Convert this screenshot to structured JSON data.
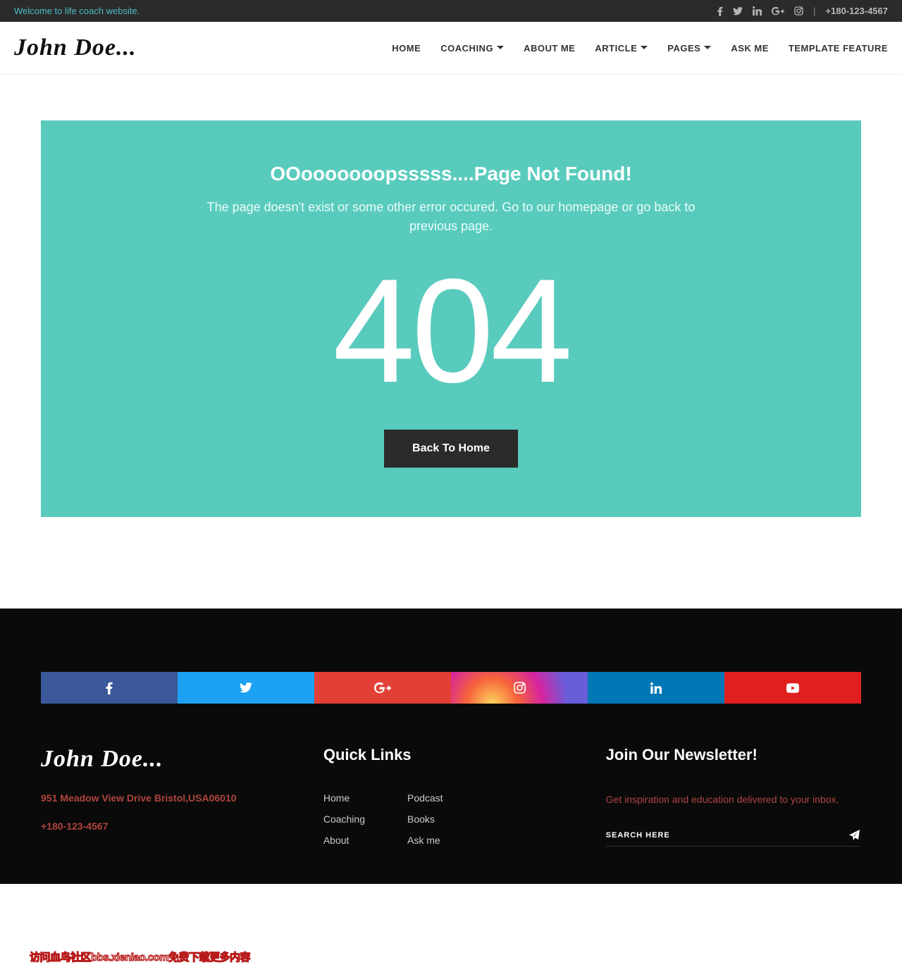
{
  "topbar": {
    "welcome": "Welcome to life coach website.",
    "phone": "+180-123-4567"
  },
  "logo": "John Doe...",
  "nav": {
    "home": "HOME",
    "coaching": "COACHING",
    "about": "ABOUT ME",
    "article": "ARTICLE",
    "pages": "PAGES",
    "ask": "ASK ME",
    "template": "TEMPLATE FEATURE"
  },
  "error": {
    "title": "OOooooooopsssss....Page Not Found!",
    "desc": "The page doesn't exist or some other error occured. Go to our homepage or go back to previous page.",
    "code": "404",
    "back": "Back To Home"
  },
  "footer": {
    "logo": "John Doe...",
    "address": "951 Meadow View Drive Bristol,USA06010",
    "phone": "+180-123-4567",
    "quick_title": "Quick Links",
    "links1": {
      "home": "Home",
      "coaching": "Coaching",
      "about": "About"
    },
    "links2": {
      "podcast": "Podcast",
      "books": "Books",
      "ask": "Ask me"
    },
    "news_title": "Join Our Newsletter!",
    "news_desc": "Get inspiration and education delivered to your inbox.",
    "search_placeholder": "SEARCH HERE"
  },
  "watermark": "访问血鸟社区bbs.xieniao.com免费下载更多内容"
}
